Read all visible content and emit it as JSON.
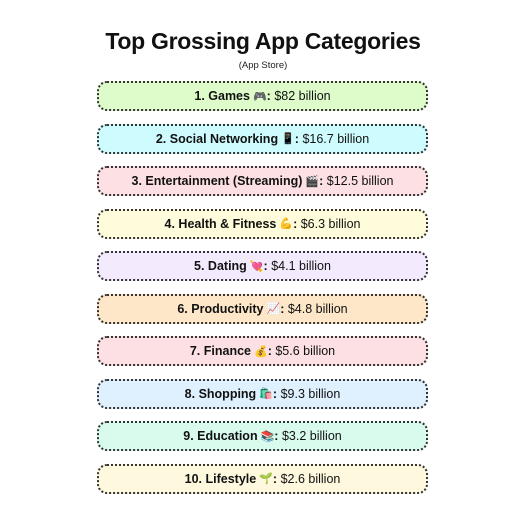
{
  "title": "Top Grossing App Categories",
  "subtitle": "(App Store)",
  "items": [
    {
      "label": "1. Games",
      "emoji": "🎮",
      "value": "$82 billion",
      "color": "#ddfcc9"
    },
    {
      "label": "2. Social Networking",
      "emoji": "📱",
      "value": "$16.7 billion",
      "color": "#cefcfe"
    },
    {
      "label": "3. Entertainment (Streaming)",
      "emoji": "🎬",
      "value": "$12.5 billion",
      "color": "#fde0e3"
    },
    {
      "label": "4. Health & Fitness",
      "emoji": "💪",
      "value": "$6.3 billion",
      "color": "#fefcda"
    },
    {
      "label": "5. Dating",
      "emoji": "💘",
      "value": "$4.1 billion",
      "color": "#f3eafe"
    },
    {
      "label": "6. Productivity",
      "emoji": "📈",
      "value": "$4.8 billion",
      "color": "#fde7c8"
    },
    {
      "label": "7. Finance",
      "emoji": "💰",
      "value": "$5.6 billion",
      "color": "#fde0e3"
    },
    {
      "label": "8. Shopping",
      "emoji": "🛍️",
      "value": "$9.3 billion",
      "color": "#dff0fe"
    },
    {
      "label": "9. Education",
      "emoji": "📚",
      "value": "$3.2 billion",
      "color": "#d9fbee"
    },
    {
      "label": "10. Lifestyle",
      "emoji": "🌱",
      "value": "$2.6 billion",
      "color": "#fdf8de"
    }
  ]
}
